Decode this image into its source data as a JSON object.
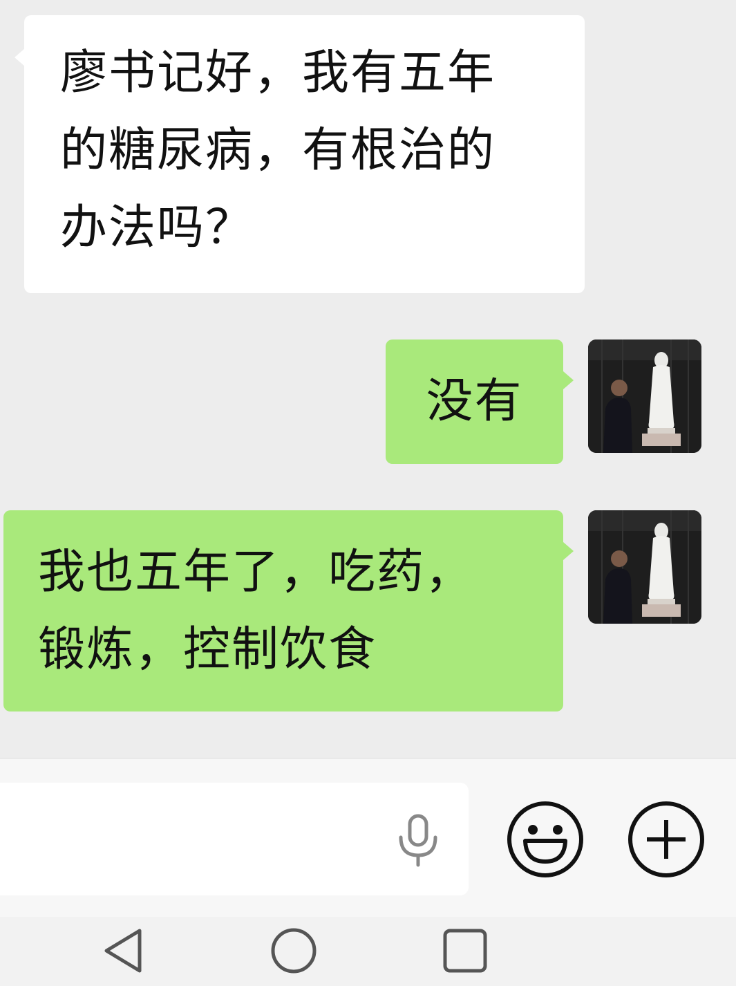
{
  "chat": {
    "messages": [
      {
        "direction": "incoming",
        "lines": [
          "廖书记好，我有五年",
          "的糖尿病，有根治的",
          "办法吗？"
        ]
      },
      {
        "direction": "outgoing",
        "text": "没有",
        "avatar": "statue-photo-avatar"
      },
      {
        "direction": "outgoing",
        "lines": [
          "我也五年了，吃药，",
          "锻炼，控制饮食"
        ],
        "avatar": "statue-photo-avatar"
      }
    ]
  },
  "input_bar": {
    "text_value": "",
    "icons": [
      "microphone-icon",
      "emoji-icon",
      "plus-icon"
    ]
  },
  "nav_bar": {
    "icons": [
      "back-triangle-icon",
      "home-circle-icon",
      "recents-square-icon"
    ]
  },
  "colors": {
    "chat_background": "#ededed",
    "incoming_bubble": "#ffffff",
    "outgoing_bubble": "#a9e97b",
    "icon_stroke": "#111111"
  }
}
